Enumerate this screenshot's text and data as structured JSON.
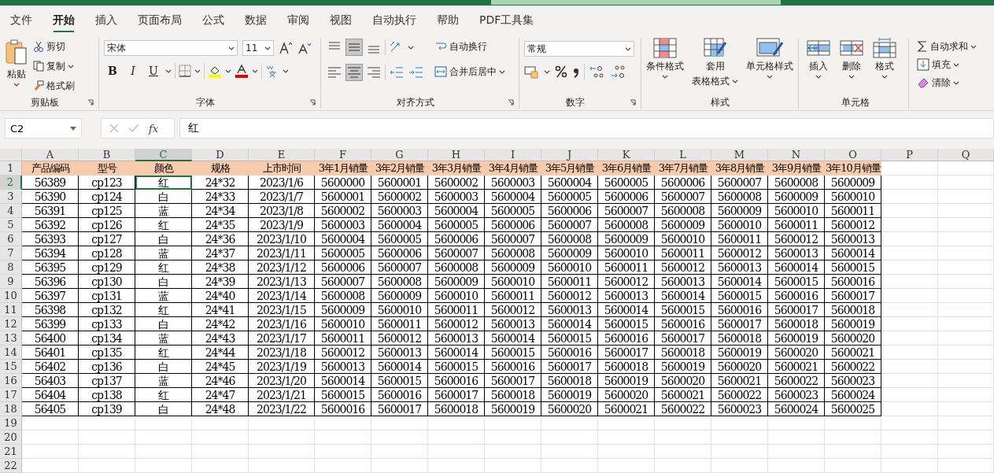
{
  "tabs": [
    {
      "label": "文件",
      "selected": false
    },
    {
      "label": "开始",
      "selected": true
    },
    {
      "label": "插入",
      "selected": false
    },
    {
      "label": "页面布局",
      "selected": false
    },
    {
      "label": "公式",
      "selected": false
    },
    {
      "label": "数据",
      "selected": false
    },
    {
      "label": "审阅",
      "selected": false
    },
    {
      "label": "视图",
      "selected": false
    },
    {
      "label": "自动执行",
      "selected": false
    },
    {
      "label": "帮助",
      "selected": false
    },
    {
      "label": "PDF工具集",
      "selected": false
    }
  ],
  "ribbon": {
    "clipboard": {
      "title": "剪贴板",
      "paste": "粘贴",
      "cut": "剪切",
      "copy": "复制",
      "format_painter": "格式刷"
    },
    "font": {
      "title": "字体",
      "font_name": "宋体",
      "font_size": "11",
      "bold": "B",
      "italic": "I",
      "underline": "U"
    },
    "alignment": {
      "title": "对齐方式",
      "wrap_text": "自动换行",
      "merge_center": "合并后居中"
    },
    "number": {
      "title": "数字",
      "format": "常规"
    },
    "styles": {
      "title": "样式",
      "conditional": "条件格式",
      "table_format": [
        "套用",
        "表格格式"
      ],
      "cell_styles": "单元格样式"
    },
    "cells": {
      "title": "单元格",
      "insert": "插入",
      "delete": "删除",
      "format": "格式"
    },
    "editing": {
      "autosum": "自动求和",
      "fill": "填充",
      "clear": "清除"
    }
  },
  "formula_bar": {
    "name_box": "C2",
    "fx": "fx",
    "value": "红"
  },
  "sheet": {
    "columns": [
      {
        "label": "A",
        "selected": false
      },
      {
        "label": "B",
        "selected": false
      },
      {
        "label": "C",
        "selected": true
      },
      {
        "label": "D",
        "selected": false
      },
      {
        "label": "E",
        "selected": false
      },
      {
        "label": "F",
        "selected": false
      },
      {
        "label": "G",
        "selected": false
      },
      {
        "label": "H",
        "selected": false
      },
      {
        "label": "I",
        "selected": false
      },
      {
        "label": "J",
        "selected": false
      },
      {
        "label": "K",
        "selected": false
      },
      {
        "label": "L",
        "selected": false
      },
      {
        "label": "M",
        "selected": false
      },
      {
        "label": "N",
        "selected": false
      },
      {
        "label": "O",
        "selected": false
      },
      {
        "label": "P",
        "selected": false
      },
      {
        "label": "Q",
        "selected": false
      }
    ],
    "rows": [
      {
        "label": "1",
        "kind": "header",
        "selected": false,
        "cells": [
          "产品编码",
          "型号",
          "颜色",
          "规格",
          "上市时间",
          "3年1月销量",
          "3年2月销量",
          "3年3月销量",
          "3年4月销量",
          "3年5月销量",
          "3年6月销量",
          "3年7月销量",
          "3年8月销量",
          "3年9月销量",
          "3年10月销量"
        ]
      },
      {
        "label": "2",
        "kind": "data",
        "selected": true,
        "cells": [
          "56389",
          "cp123",
          "红",
          "24*32",
          "2023/1/6",
          "5600000",
          "5600001",
          "5600002",
          "5600003",
          "5600004",
          "5600005",
          "5600006",
          "5600007",
          "5600008",
          "5600009"
        ]
      },
      {
        "label": "3",
        "kind": "data",
        "selected": false,
        "cells": [
          "56390",
          "cp124",
          "白",
          "24*33",
          "2023/1/7",
          "5600001",
          "5600002",
          "5600003",
          "5600004",
          "5600005",
          "5600006",
          "5600007",
          "5600008",
          "5600009",
          "5600010"
        ]
      },
      {
        "label": "4",
        "kind": "data",
        "selected": false,
        "cells": [
          "56391",
          "cp125",
          "蓝",
          "24*34",
          "2023/1/8",
          "5600002",
          "5600003",
          "5600004",
          "5600005",
          "5600006",
          "5600007",
          "5600008",
          "5600009",
          "5600010",
          "5600011"
        ]
      },
      {
        "label": "5",
        "kind": "data",
        "selected": false,
        "cells": [
          "56392",
          "cp126",
          "红",
          "24*35",
          "2023/1/9",
          "5600003",
          "5600004",
          "5600005",
          "5600006",
          "5600007",
          "5600008",
          "5600009",
          "5600010",
          "5600011",
          "5600012"
        ]
      },
      {
        "label": "6",
        "kind": "data",
        "selected": false,
        "cells": [
          "56393",
          "cp127",
          "白",
          "24*36",
          "2023/1/10",
          "5600004",
          "5600005",
          "5600006",
          "5600007",
          "5600008",
          "5600009",
          "5600010",
          "5600011",
          "5600012",
          "5600013"
        ]
      },
      {
        "label": "7",
        "kind": "data",
        "selected": false,
        "cells": [
          "56394",
          "cp128",
          "蓝",
          "24*37",
          "2023/1/11",
          "5600005",
          "5600006",
          "5600007",
          "5600008",
          "5600009",
          "5600010",
          "5600011",
          "5600012",
          "5600013",
          "5600014"
        ]
      },
      {
        "label": "8",
        "kind": "data",
        "selected": false,
        "cells": [
          "56395",
          "cp129",
          "红",
          "24*38",
          "2023/1/12",
          "5600006",
          "5600007",
          "5600008",
          "5600009",
          "5600010",
          "5600011",
          "5600012",
          "5600013",
          "5600014",
          "5600015"
        ]
      },
      {
        "label": "9",
        "kind": "data",
        "selected": false,
        "cells": [
          "56396",
          "cp130",
          "白",
          "24*39",
          "2023/1/13",
          "5600007",
          "5600008",
          "5600009",
          "5600010",
          "5600011",
          "5600012",
          "5600013",
          "5600014",
          "5600015",
          "5600016"
        ]
      },
      {
        "label": "10",
        "kind": "data",
        "selected": false,
        "cells": [
          "56397",
          "cp131",
          "蓝",
          "24*40",
          "2023/1/14",
          "5600008",
          "5600009",
          "5600010",
          "5600011",
          "5600012",
          "5600013",
          "5600014",
          "5600015",
          "5600016",
          "5600017"
        ]
      },
      {
        "label": "11",
        "kind": "data",
        "selected": false,
        "cells": [
          "56398",
          "cp132",
          "红",
          "24*41",
          "2023/1/15",
          "5600009",
          "5600010",
          "5600011",
          "5600012",
          "5600013",
          "5600014",
          "5600015",
          "5600016",
          "5600017",
          "5600018"
        ]
      },
      {
        "label": "12",
        "kind": "data",
        "selected": false,
        "cells": [
          "56399",
          "cp133",
          "白",
          "24*42",
          "2023/1/16",
          "5600010",
          "5600011",
          "5600012",
          "5600013",
          "5600014",
          "5600015",
          "5600016",
          "5600017",
          "5600018",
          "5600019"
        ]
      },
      {
        "label": "13",
        "kind": "data",
        "selected": false,
        "cells": [
          "56400",
          "cp134",
          "蓝",
          "24*43",
          "2023/1/17",
          "5600011",
          "5600012",
          "5600013",
          "5600014",
          "5600015",
          "5600016",
          "5600017",
          "5600018",
          "5600019",
          "5600020"
        ]
      },
      {
        "label": "14",
        "kind": "data",
        "selected": false,
        "cells": [
          "56401",
          "cp135",
          "红",
          "24*44",
          "2023/1/18",
          "5600012",
          "5600013",
          "5600014",
          "5600015",
          "5600016",
          "5600017",
          "5600018",
          "5600019",
          "5600020",
          "5600021"
        ]
      },
      {
        "label": "15",
        "kind": "data",
        "selected": false,
        "cells": [
          "56402",
          "cp136",
          "白",
          "24*45",
          "2023/1/19",
          "5600013",
          "5600014",
          "5600015",
          "5600016",
          "5600017",
          "5600018",
          "5600019",
          "5600020",
          "5600021",
          "5600022"
        ]
      },
      {
        "label": "16",
        "kind": "data",
        "selected": false,
        "cells": [
          "56403",
          "cp137",
          "蓝",
          "24*46",
          "2023/1/20",
          "5600014",
          "5600015",
          "5600016",
          "5600017",
          "5600018",
          "5600019",
          "5600020",
          "5600021",
          "5600022",
          "5600023"
        ]
      },
      {
        "label": "17",
        "kind": "data",
        "selected": false,
        "cells": [
          "56404",
          "cp138",
          "红",
          "24*47",
          "2023/1/21",
          "5600015",
          "5600016",
          "5600017",
          "5600018",
          "5600019",
          "5600020",
          "5600021",
          "5600022",
          "5600023",
          "5600024"
        ]
      },
      {
        "label": "18",
        "kind": "data",
        "selected": false,
        "cells": [
          "56405",
          "cp139",
          "白",
          "24*48",
          "2023/1/22",
          "5600016",
          "5600017",
          "5600018",
          "5600019",
          "5600020",
          "5600021",
          "5600022",
          "5600023",
          "5600024",
          "5600025"
        ]
      },
      {
        "label": "19",
        "kind": "empty",
        "selected": false
      },
      {
        "label": "20",
        "kind": "empty",
        "selected": false
      },
      {
        "label": "21",
        "kind": "empty",
        "selected": false
      },
      {
        "label": "22",
        "kind": "empty",
        "selected": false
      }
    ]
  }
}
